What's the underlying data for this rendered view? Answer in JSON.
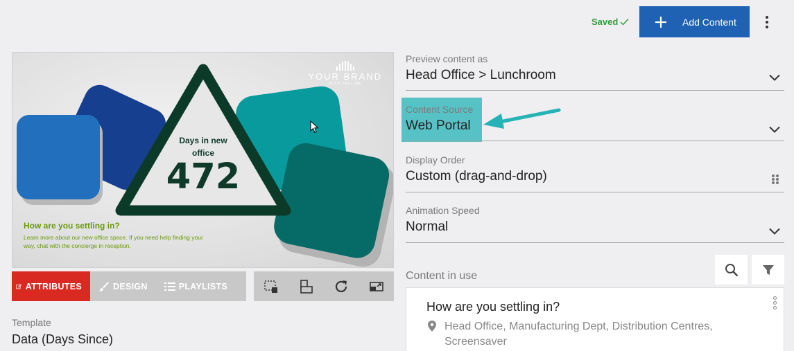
{
  "header": {
    "saved_label": "Saved",
    "add_button_label": "Add Content"
  },
  "preview": {
    "brand_name": "YOUR BRAND",
    "brand_tagline": "WITH TAGLINE",
    "counter_label": "Days in new office",
    "counter_value": "472",
    "headline": "How are you settling in?",
    "body": "Learn more about our new office space. If you need help finding your way, chat with the concierge in reception."
  },
  "tabs": [
    {
      "label": "ATTRIBUTES",
      "icon": "edit-icon",
      "active": true
    },
    {
      "label": "DESIGN",
      "icon": "brush-icon",
      "active": false
    },
    {
      "label": "PLAYLISTS",
      "icon": "list-icon",
      "active": false
    }
  ],
  "tools": [
    "region-select-icon",
    "layers-icon",
    "refresh-icon",
    "resize-icon"
  ],
  "template": {
    "label": "Template",
    "value": "Data (Days Since)"
  },
  "fields": {
    "preview_as": {
      "label": "Preview content as",
      "value": "Head Office > Lunchroom"
    },
    "content_source": {
      "label": "Content Source",
      "value": "Web Portal"
    },
    "display_order": {
      "label": "Display Order",
      "value": "Custom (drag-and-drop)"
    },
    "animation_speed": {
      "label": "Animation Speed",
      "value": "Normal"
    }
  },
  "content_in_use": {
    "label": "Content in use",
    "items": [
      {
        "title": "How are you settling in?",
        "locations": "Head Office, Manufacturing Dept, Distribution Centres, Screensaver"
      }
    ]
  },
  "colors": {
    "accent_blue": "#1f61b2",
    "attributes_red": "#d92a22",
    "highlight_teal": "#57c2c5",
    "saved_green": "#2e9e3e",
    "arrow_teal": "#26b3b5"
  }
}
